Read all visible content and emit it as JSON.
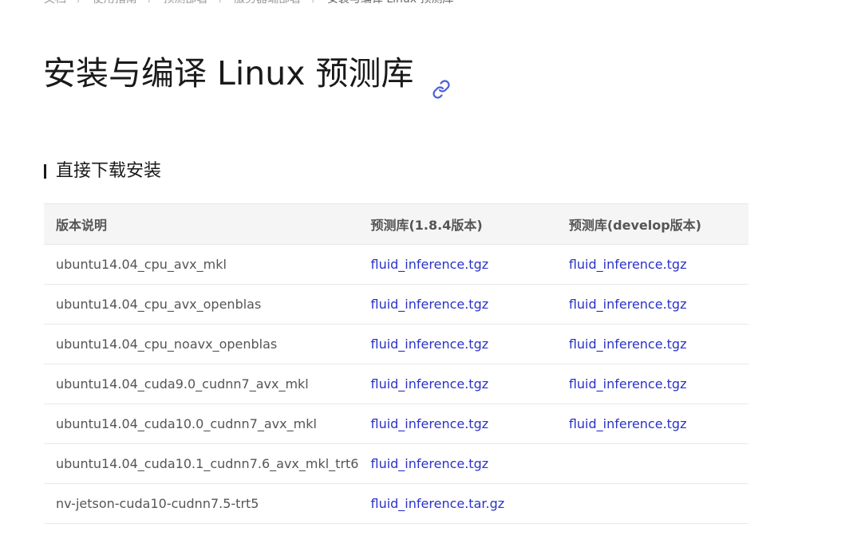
{
  "breadcrumb": {
    "items": [
      "文档",
      "使用指南",
      "预测部署",
      "服务器端部署",
      "安装与编译 Linux 预测库"
    ]
  },
  "page": {
    "title": "安装与编译 Linux 预测库",
    "anchor_icon": "link-icon"
  },
  "section": {
    "heading": "直接下载安装"
  },
  "table": {
    "headers": [
      "版本说明",
      "预测库(1.8.4版本)",
      "预测库(develop版本)"
    ],
    "rows": [
      {
        "version": "ubuntu14.04_cpu_avx_mkl",
        "stable": "fluid_inference.tgz",
        "develop": "fluid_inference.tgz"
      },
      {
        "version": "ubuntu14.04_cpu_avx_openblas",
        "stable": "fluid_inference.tgz",
        "develop": "fluid_inference.tgz"
      },
      {
        "version": "ubuntu14.04_cpu_noavx_openblas",
        "stable": "fluid_inference.tgz",
        "develop": "fluid_inference.tgz"
      },
      {
        "version": "ubuntu14.04_cuda9.0_cudnn7_avx_mkl",
        "stable": "fluid_inference.tgz",
        "develop": "fluid_inference.tgz"
      },
      {
        "version": "ubuntu14.04_cuda10.0_cudnn7_avx_mkl",
        "stable": "fluid_inference.tgz",
        "develop": "fluid_inference.tgz"
      },
      {
        "version": "ubuntu14.04_cuda10.1_cudnn7.6_avx_mkl_trt6",
        "stable": "fluid_inference.tgz",
        "develop": ""
      },
      {
        "version": "nv-jetson-cuda10-cudnn7.5-trt5",
        "stable": "fluid_inference.tar.gz",
        "develop": ""
      }
    ]
  },
  "colors": {
    "link": "#2932c8",
    "text": "#555555",
    "title": "#1a1a1a",
    "header_bg": "#f5f5f5",
    "border": "#e8e8e8"
  }
}
